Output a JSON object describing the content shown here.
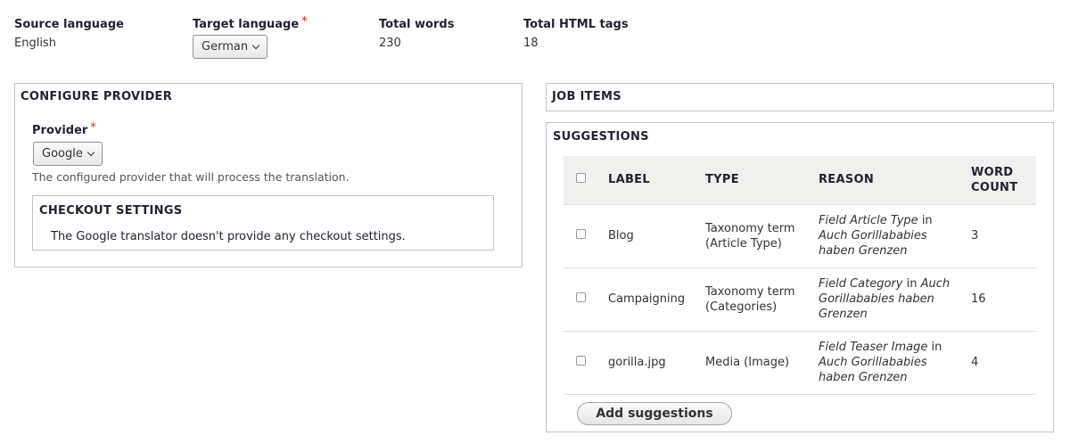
{
  "meta": {
    "source_language_label": "Source language",
    "source_language_value": "English",
    "target_language_label": "Target language",
    "target_language_value": "German",
    "total_words_label": "Total words",
    "total_words_value": "230",
    "total_tags_label": "Total HTML tags",
    "total_tags_value": "18",
    "required_mark": "*"
  },
  "provider": {
    "legend": "CONFIGURE PROVIDER",
    "label": "Provider",
    "selected": "Google",
    "description": "The configured provider that will process the translation.",
    "checkout": {
      "legend": "CHECKOUT SETTINGS",
      "message": "The Google translator doesn't provide any checkout settings."
    }
  },
  "job_items": {
    "legend": "JOB ITEMS"
  },
  "suggestions": {
    "legend": "SUGGESTIONS",
    "headers": {
      "label": "LABEL",
      "type": "TYPE",
      "reason": "REASON",
      "word_count_1": "WORD",
      "word_count_2": "COUNT"
    },
    "rows": [
      {
        "label": "Blog",
        "type_1": "Taxonomy term",
        "type_2": "(Article Type)",
        "reason_em_1": "Field Article Type",
        "reason_plain_1": " in",
        "reason_em_2": "Auch Gorillababies",
        "reason_em_3": "haben Grenzen",
        "count": "3"
      },
      {
        "label": "Campaigning",
        "type_1": "Taxonomy term",
        "type_2": "(Categories)",
        "reason_em_1": "Field Category",
        "reason_plain_1": " in ",
        "reason_em_1b": "Auch",
        "reason_em_2": "Gorillababies haben",
        "reason_em_3": "Grenzen",
        "count": "16"
      },
      {
        "label": "gorilla.jpg",
        "type_1": "Media (Image)",
        "type_2": "",
        "reason_em_1": "Field Teaser Image",
        "reason_plain_1": " in",
        "reason_em_2": "Auch Gorillababies",
        "reason_em_3": "haben Grenzen",
        "count": "4"
      }
    ],
    "add_button": "Add suggestions"
  }
}
